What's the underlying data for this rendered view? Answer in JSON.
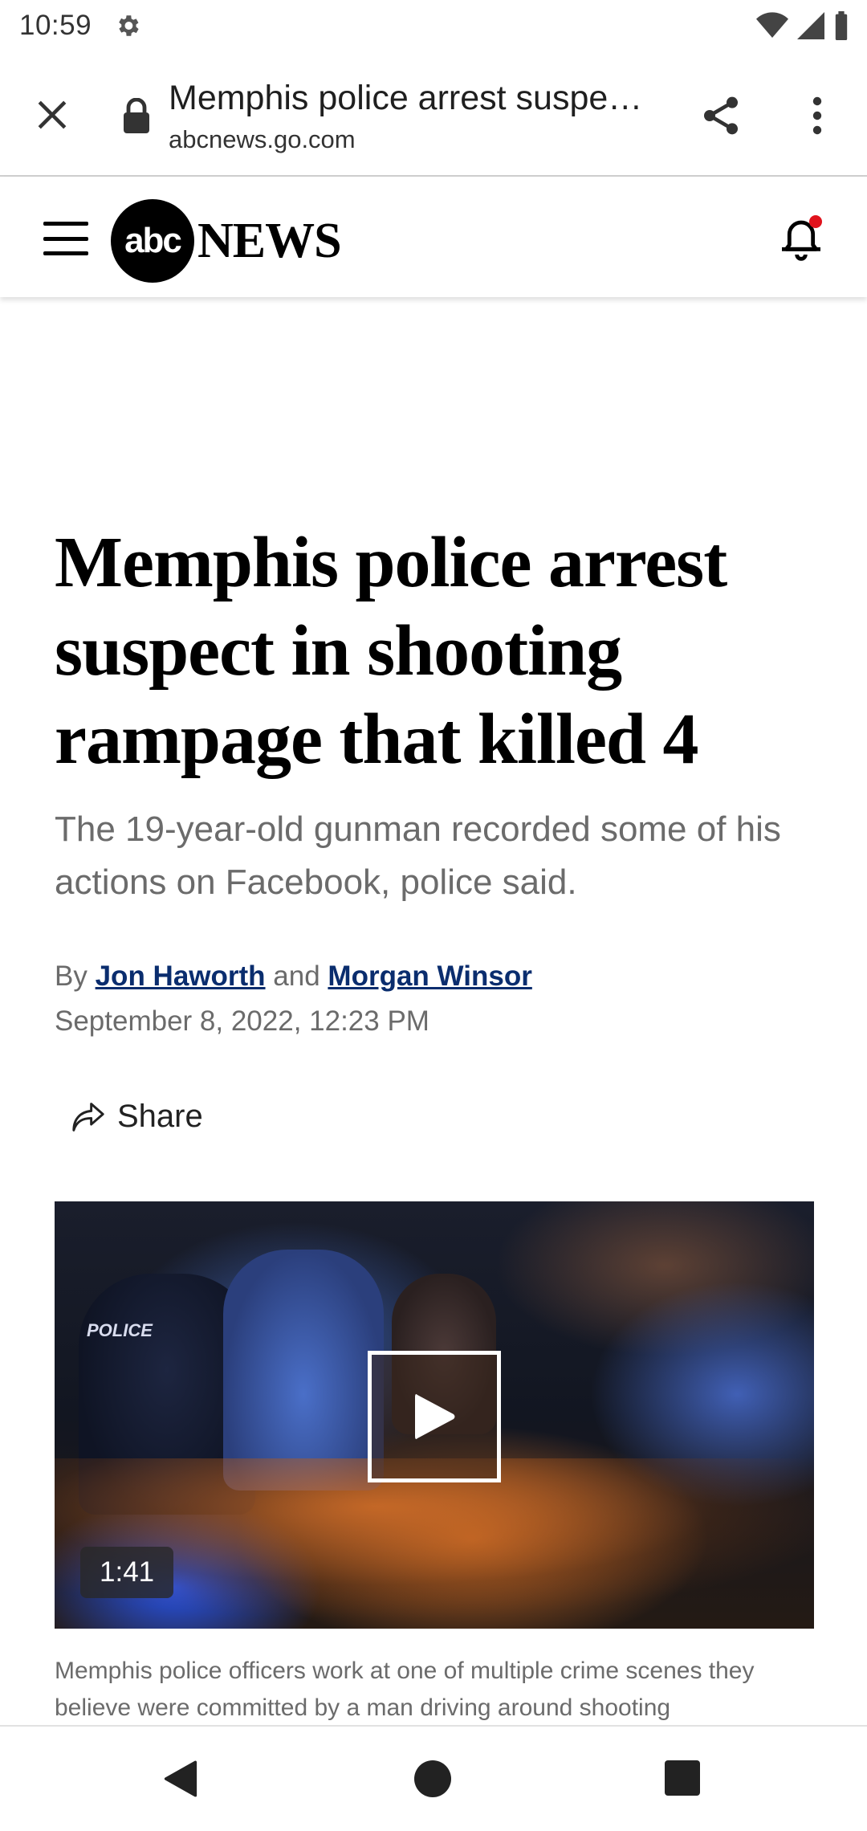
{
  "status_bar": {
    "time": "10:59",
    "icons": [
      "gear-icon",
      "wifi-icon",
      "signal-icon",
      "battery-icon"
    ]
  },
  "browser": {
    "page_title": "Memphis police arrest suspe…",
    "domain": "abcnews.go.com",
    "icons": [
      "close-icon",
      "lock-icon",
      "share-icon",
      "more-vert-icon"
    ]
  },
  "site_header": {
    "logo_circle_text": "abc",
    "logo_word": "NEWS",
    "icons": [
      "hamburger-menu-icon",
      "notification-bell-icon"
    ],
    "colors": {
      "notification_dot": "#e0121c"
    }
  },
  "article": {
    "headline": "Memphis police arrest suspect in shooting rampage that killed 4",
    "dek": "The 19-year-old gunman recorded some of his actions on Facebook, police said.",
    "byline_prefix": "By",
    "author_1": "Jon Haworth",
    "byline_conjunction": "and",
    "author_2": "Morgan Winsor",
    "date": "September 8, 2022, 12:23 PM",
    "share_label": "Share",
    "video": {
      "duration": "1:41",
      "overlay_text": "POLICE"
    },
    "caption": "Memphis police officers work at one of multiple crime scenes they believe were committed by a man driving around shooting"
  },
  "colors": {
    "link": "#0a2d6e",
    "secondary_text": "#6b6b6b"
  }
}
